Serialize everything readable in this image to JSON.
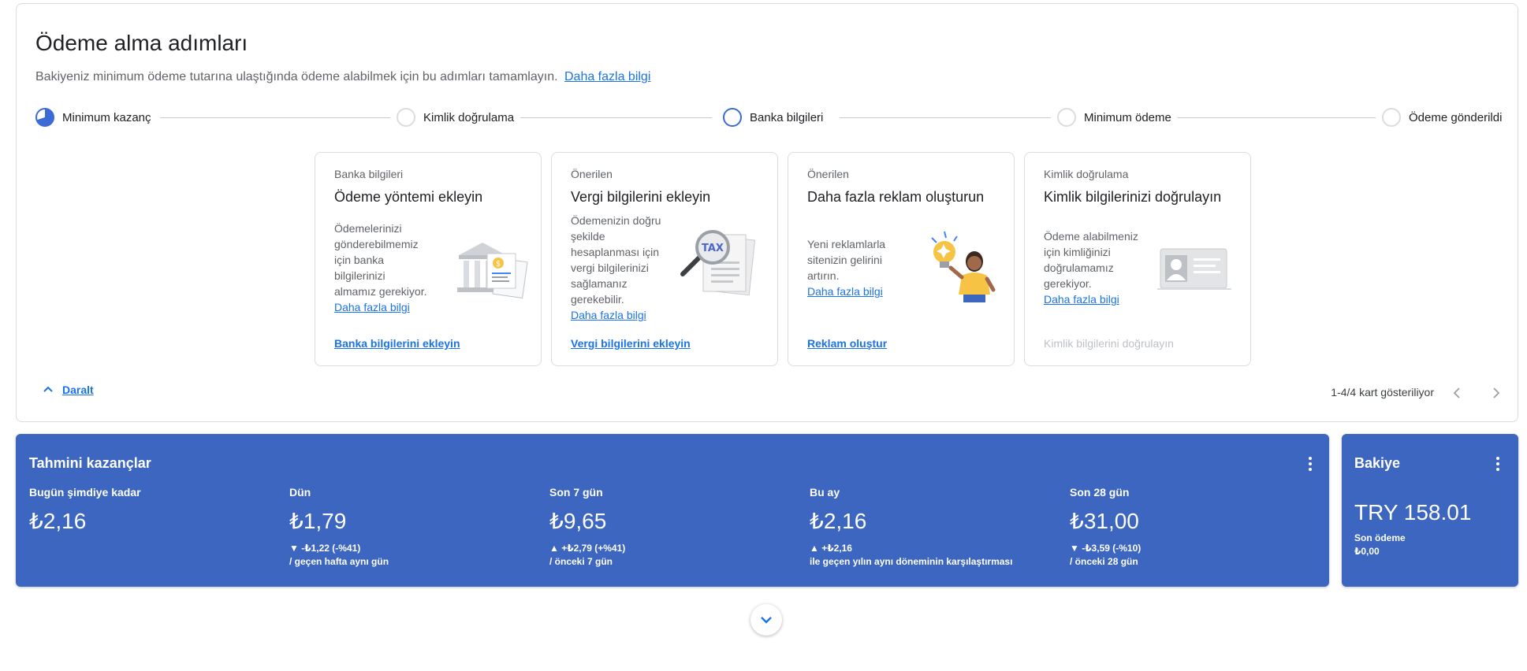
{
  "steps_section": {
    "title": "Ödeme alma adımları",
    "description": "Bakiyeniz minimum ödeme tutarına ulaştığında ödeme alabilmek için bu adımları tamamlayın.",
    "learn_more": "Daha fazla bilgi",
    "steps": [
      {
        "label": "Minimum kazanç",
        "state": "in-progress"
      },
      {
        "label": "Kimlik doğrulama",
        "state": "pending"
      },
      {
        "label": "Banka bilgileri",
        "state": "active"
      },
      {
        "label": "Minimum ödeme",
        "state": "pending"
      },
      {
        "label": "Ödeme gönderildi",
        "state": "pending"
      }
    ],
    "cards": [
      {
        "category": "Banka bilgileri",
        "title": "Ödeme yöntemi ekleyin",
        "lines": [
          "Ödemelerinizi",
          "gönderebilmemiz",
          "için banka",
          "bilgilerinizi",
          "almamız gerekiyor."
        ],
        "link": "Daha fazla bilgi",
        "action": "Banka bilgilerini ekleyin",
        "icon": "bank-icon"
      },
      {
        "category": "Önerilen",
        "title": "Vergi bilgilerini ekleyin",
        "lines": [
          "Ödemenizin doğru",
          "şekilde",
          "hesaplanması için",
          "vergi bilgilerinizi",
          "sağlamanız",
          "gerekebilir."
        ],
        "link": "Daha fazla bilgi",
        "action": "Vergi bilgilerini ekleyin",
        "icon": "tax-icon",
        "icon_text": "TAX"
      },
      {
        "category": "Önerilen",
        "title": "Daha fazla reklam oluşturun",
        "lines": [
          "Yeni reklamlarla",
          "sitenizin gelirini",
          "artırın."
        ],
        "link": "Daha fazla bilgi",
        "action": "Reklam oluştur",
        "icon": "idea-person-icon"
      },
      {
        "category": "Kimlik doğrulama",
        "title": "Kimlik bilgilerinizi doğrulayın",
        "lines": [
          "Ödeme alabilmeniz",
          "için kimliğinizi",
          "doğrulamamız",
          "gerekiyor."
        ],
        "link": "Daha fazla bilgi",
        "action": "Kimlik bilgilerini doğrulayın",
        "action_disabled": true,
        "icon": "id-card-icon"
      }
    ],
    "collapse_label": "Daralt",
    "pager_text": "1-4/4 kart gösteriliyor"
  },
  "earnings": {
    "title": "Tahmini kazançlar",
    "metrics": [
      {
        "label": "Bugün şimdiye kadar",
        "value": "₺2,16",
        "delta": "",
        "compare": ""
      },
      {
        "label": "Dün",
        "value": "₺1,79",
        "delta": "▼ -₺1,22 (-%41)",
        "compare": "/ geçen hafta aynı gün"
      },
      {
        "label": "Son 7 gün",
        "value": "₺9,65",
        "delta": "▲ +₺2,79 (+%41)",
        "compare": "/ önceki 7 gün"
      },
      {
        "label": "Bu ay",
        "value": "₺2,16",
        "delta": "▲ +₺2,16",
        "compare": "ile geçen yılın aynı döneminin karşılaştırması"
      },
      {
        "label": "Son 28 gün",
        "value": "₺31,00",
        "delta": "▼ -₺3,59 (-%10)",
        "compare": "/ önceki 28 gün"
      }
    ]
  },
  "balance": {
    "title": "Bakiye",
    "value": "TRY 158.01",
    "last_payment_label": "Son ödeme",
    "last_payment_value": "₺0,00"
  },
  "colors": {
    "accent": "#1a73e8",
    "card_blue": "#3c66bf",
    "step_active": "#3c6bd6"
  }
}
